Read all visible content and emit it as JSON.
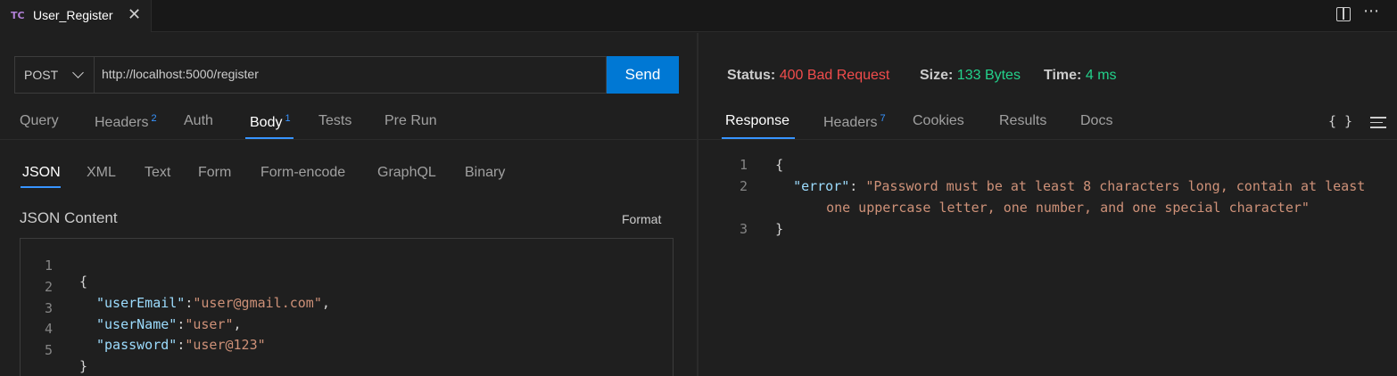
{
  "tab": {
    "icon": "TC",
    "title": "User_Register"
  },
  "request": {
    "method": "POST",
    "url": "http://localhost:5000/register",
    "send_label": "Send",
    "tabs": [
      {
        "label": "Query",
        "badge": ""
      },
      {
        "label": "Headers",
        "badge": "2"
      },
      {
        "label": "Auth",
        "badge": ""
      },
      {
        "label": "Body",
        "badge": "1",
        "active": true
      },
      {
        "label": "Tests",
        "badge": ""
      },
      {
        "label": "Pre Run",
        "badge": ""
      }
    ],
    "body_tabs": [
      "JSON",
      "XML",
      "Text",
      "Form",
      "Form-encode",
      "GraphQL",
      "Binary"
    ],
    "content_label": "JSON Content",
    "format_label": "Format",
    "code_lines": {
      "n": [
        "1",
        "2",
        "3",
        "4",
        "5"
      ],
      "open": "{",
      "close": "}",
      "fields": [
        {
          "key": "\"userEmail\"",
          "colon": ":",
          "value": "\"user@gmail.com\"",
          "comma": ","
        },
        {
          "key": "\"userName\"",
          "colon": ":",
          "value": "\"user\"",
          "comma": ","
        },
        {
          "key": "\"password\"",
          "colon": ":",
          "value": "\"user@123\"",
          "comma": ""
        }
      ]
    }
  },
  "response": {
    "status_label": "Status:",
    "status_value": "400 Bad Request",
    "size_label": "Size:",
    "size_value": "133 Bytes",
    "time_label": "Time:",
    "time_value": "4 ms",
    "tabs": [
      {
        "label": "Response",
        "badge": "",
        "active": true
      },
      {
        "label": "Headers",
        "badge": "7"
      },
      {
        "label": "Cookies",
        "badge": ""
      },
      {
        "label": "Results",
        "badge": ""
      },
      {
        "label": "Docs",
        "badge": ""
      }
    ],
    "brace_icon": "{ }",
    "lines": {
      "n": [
        "1",
        "2",
        "3"
      ],
      "open": "{",
      "key": "\"error\"",
      "colon": ": ",
      "value_line1": "\"Password must be at least 8 characters long, contain at least",
      "value_line2": "one uppercase letter, one number, and one special character\"",
      "close": "}"
    }
  },
  "colors": {
    "accent": "#0078d4",
    "error": "#f14c4c",
    "success": "#23d18b",
    "json_key": "#9cdcfe",
    "json_string": "#ce9178"
  }
}
